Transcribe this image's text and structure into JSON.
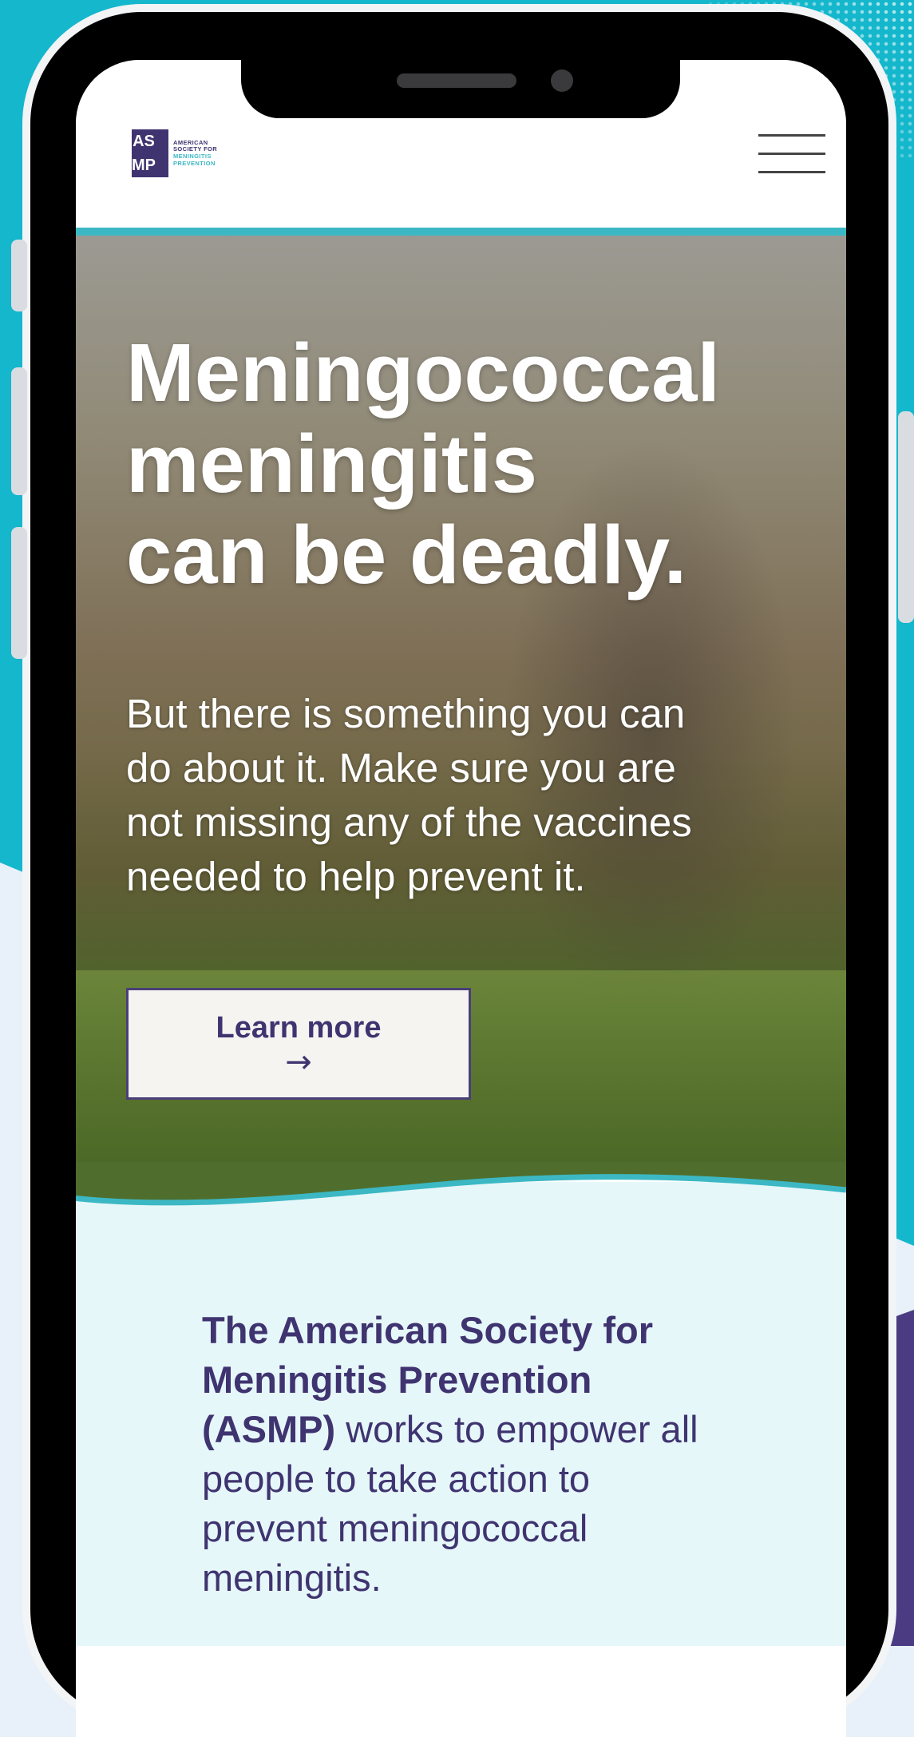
{
  "colors": {
    "background_teal": "#14b7cc",
    "brand_purple": "#3f3470",
    "accent_teal": "#3cb8c4",
    "mission_bg": "#e6f7f9"
  },
  "header": {
    "logo": {
      "letters": [
        "AS",
        "MP"
      ],
      "text_lines": [
        "AMERICAN",
        "SOCIETY FOR",
        "MENINGITIS",
        "PREVENTION"
      ]
    },
    "menu_icon": "hamburger-menu-icon"
  },
  "hero": {
    "title": "Meningococcal\nmeningitis\ncan be deadly.",
    "body": "But there is something you can\ndo about it. Make sure you are\nnot missing any of the vaccines\nneeded to help prevent it.",
    "cta_label": "Learn more",
    "cta_arrow": "→"
  },
  "mission": {
    "bold": "The American Society for Meningitis Prevention (ASMP)",
    "rest": " works to empower all people to take action to prevent meningococcal meningitis."
  }
}
